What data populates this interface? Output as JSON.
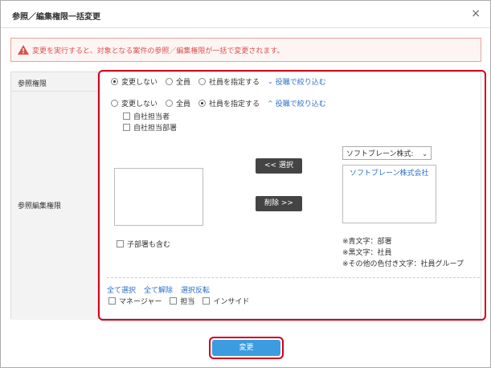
{
  "dialog": {
    "title": "参照／編集権限一括変更",
    "close_symbol": "×"
  },
  "alert": {
    "message": "変更を実行すると、対象となる案件の参照／編集権限が一括で変更されます。",
    "icon": "warning-icon"
  },
  "view_permission": {
    "label": "参照権限",
    "options": [
      "変更しない",
      "全員",
      "社員を指定する"
    ],
    "selected": "変更しない",
    "filter_link": "役職で絞り込む"
  },
  "edit_permission": {
    "label": "参照編集権限",
    "options": [
      "変更しない",
      "全員",
      "社員を指定する"
    ],
    "selected": "社員を指定する",
    "filter_link": "役職で絞り込む",
    "checkboxes": [
      "自社担当者",
      "自社担当部署"
    ],
    "select_button": "<< 選択",
    "remove_button": "削除 >>",
    "company_select": "ソフトブレーン株式:",
    "company_list": [
      "ソフトブレーン株式会社"
    ],
    "include_sub": "子部署も含む",
    "notes": [
      "※青文字：部署",
      "※黒文字：社員",
      "※その他の色付き文字：社員グループ"
    ],
    "role_links": [
      "全て選択",
      "全て解除",
      "選択反転"
    ],
    "roles": [
      "マネージャー",
      "担当",
      "インサイド"
    ]
  },
  "footer": {
    "submit_label": "変更"
  },
  "colors": {
    "accent": "#3b9de0",
    "highlight": "#d0001b",
    "link": "#2a6fc9"
  }
}
